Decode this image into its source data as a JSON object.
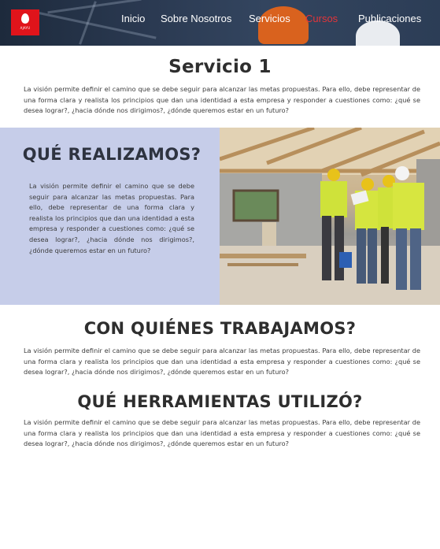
{
  "header": {
    "logo_text": "AJAYU",
    "nav": [
      {
        "label": "Inicio",
        "active": false
      },
      {
        "label": "Sobre Nosotros",
        "active": false
      },
      {
        "label": "Servicios",
        "active": false
      },
      {
        "label": "Cursos",
        "active": true
      },
      {
        "label": "Publicaciones",
        "active": false
      }
    ]
  },
  "colors": {
    "brand_red": "#e0141b",
    "active_nav": "#e3353a",
    "section_bg": "#c6cde9"
  },
  "service": {
    "title": "Servicio 1",
    "text": "La visión permite definir el camino que se debe seguir para alcanzar las metas propuestas. Para ello, debe representar de una forma clara y realista los principios que dan una identidad a esta empresa y responder a cuestiones como: ¿qué se desea lograr?, ¿hacia dónde nos dirigimos?, ¿dónde queremos estar en un futuro?"
  },
  "realizamos": {
    "title": "QUÉ REALIZAMOS?",
    "text": "La visión permite definir el camino que se debe seguir para alcanzar las metas propuestas. Para ello, debe representar de una forma clara y realista los principios que dan una identidad a esta empresa y responder a cuestiones como: ¿qué se desea lograr?, ¿hacia dónde nos dirigimos?, ¿dónde queremos estar en un futuro?"
  },
  "trabajamos": {
    "title": "CON QUIÉNES TRABAJAMOS?",
    "text": "La visión permite definir el camino que se debe seguir para alcanzar las metas propuestas. Para ello, debe representar de una forma clara y realista los principios que dan una identidad a esta empresa y responder a cuestiones como: ¿qué se desea lograr?, ¿hacia dónde nos dirigimos?, ¿dónde queremos estar en un futuro?"
  },
  "herramientas": {
    "title": "QUÉ HERRAMIENTAS UTILIZÓ?",
    "text": "La visión permite definir el camino que se debe seguir para alcanzar las metas propuestas. Para ello, debe representar de una forma clara y realista los principios que dan una identidad a esta empresa y responder a cuestiones como: ¿qué se desea lograr?, ¿hacia dónde nos dirigimos?, ¿dónde queremos estar en un futuro?"
  }
}
